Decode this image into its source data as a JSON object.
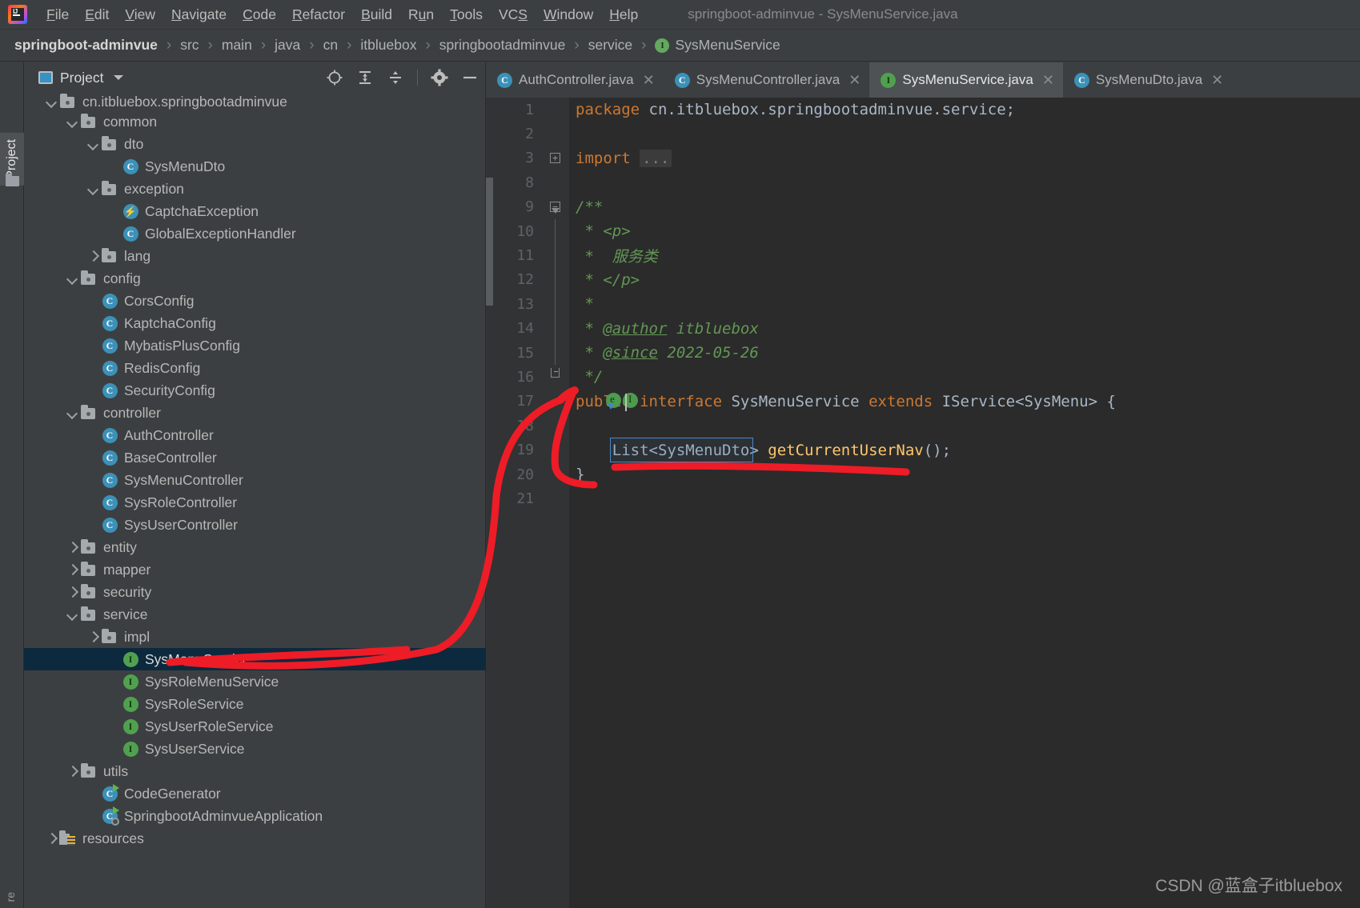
{
  "window": {
    "title": "springboot-adminvue - SysMenuService.java",
    "logo_icon": "intellij-idea-logo"
  },
  "menubar": {
    "items": [
      {
        "label": "File",
        "mnemonic": "F"
      },
      {
        "label": "Edit",
        "mnemonic": "E"
      },
      {
        "label": "View",
        "mnemonic": "V"
      },
      {
        "label": "Navigate",
        "mnemonic": "N"
      },
      {
        "label": "Code",
        "mnemonic": "C"
      },
      {
        "label": "Refactor",
        "mnemonic": "R"
      },
      {
        "label": "Build",
        "mnemonic": "B"
      },
      {
        "label": "Run",
        "mnemonic": "u"
      },
      {
        "label": "Tools",
        "mnemonic": "T"
      },
      {
        "label": "VCS",
        "mnemonic": "S"
      },
      {
        "label": "Window",
        "mnemonic": "W"
      },
      {
        "label": "Help",
        "mnemonic": "H"
      }
    ]
  },
  "breadcrumb": {
    "separator": "›",
    "items": [
      {
        "label": "springboot-adminvue",
        "icon": null
      },
      {
        "label": "src",
        "icon": null
      },
      {
        "label": "main",
        "icon": null
      },
      {
        "label": "java",
        "icon": null
      },
      {
        "label": "cn",
        "icon": null
      },
      {
        "label": "itbluebox",
        "icon": null
      },
      {
        "label": "springbootadminvue",
        "icon": null
      },
      {
        "label": "service",
        "icon": null
      },
      {
        "label": "SysMenuService",
        "icon": "interface-badge"
      }
    ]
  },
  "left_strip": {
    "tab_label": "Project",
    "tab_icon": "project-folder-icon",
    "bottom_label": "re"
  },
  "project_panel": {
    "title": "Project",
    "title_icon": "project-view-icon",
    "caret_icon": "chevron-down-icon",
    "toolbar": [
      {
        "name": "select-opened-file-icon",
        "label": "Select Opened File"
      },
      {
        "name": "expand-all-icon",
        "label": "Expand All"
      },
      {
        "name": "collapse-all-icon",
        "label": "Collapse All"
      },
      {
        "name": "gear-icon",
        "label": "Settings"
      },
      {
        "name": "hide-icon",
        "label": "Hide"
      }
    ],
    "tree": [
      {
        "label": "cn.itbluebox.springbootadminvue",
        "indent": 2,
        "twist": "down",
        "icon": "package",
        "clipped": true,
        "selected": false
      },
      {
        "label": "common",
        "indent": 3,
        "twist": "down",
        "icon": "folder",
        "selected": false
      },
      {
        "label": "dto",
        "indent": 4,
        "twist": "down",
        "icon": "folder",
        "selected": false
      },
      {
        "label": "SysMenuDto",
        "indent": 5,
        "twist": "none",
        "icon": "class",
        "selected": false
      },
      {
        "label": "exception",
        "indent": 4,
        "twist": "down",
        "icon": "folder",
        "selected": false
      },
      {
        "label": "CaptchaException",
        "indent": 5,
        "twist": "none",
        "icon": "exception",
        "selected": false
      },
      {
        "label": "GlobalExceptionHandler",
        "indent": 5,
        "twist": "none",
        "icon": "class",
        "selected": false
      },
      {
        "label": "lang",
        "indent": 4,
        "twist": "right",
        "icon": "folder",
        "selected": false
      },
      {
        "label": "config",
        "indent": 3,
        "twist": "down",
        "icon": "folder",
        "selected": false
      },
      {
        "label": "CorsConfig",
        "indent": 4,
        "twist": "none",
        "icon": "class",
        "selected": false
      },
      {
        "label": "KaptchaConfig",
        "indent": 4,
        "twist": "none",
        "icon": "class",
        "selected": false
      },
      {
        "label": "MybatisPlusConfig",
        "indent": 4,
        "twist": "none",
        "icon": "class",
        "selected": false
      },
      {
        "label": "RedisConfig",
        "indent": 4,
        "twist": "none",
        "icon": "class",
        "selected": false
      },
      {
        "label": "SecurityConfig",
        "indent": 4,
        "twist": "none",
        "icon": "class",
        "selected": false
      },
      {
        "label": "controller",
        "indent": 3,
        "twist": "down",
        "icon": "folder",
        "selected": false
      },
      {
        "label": "AuthController",
        "indent": 4,
        "twist": "none",
        "icon": "class",
        "selected": false
      },
      {
        "label": "BaseController",
        "indent": 4,
        "twist": "none",
        "icon": "class",
        "selected": false
      },
      {
        "label": "SysMenuController",
        "indent": 4,
        "twist": "none",
        "icon": "class",
        "selected": false
      },
      {
        "label": "SysRoleController",
        "indent": 4,
        "twist": "none",
        "icon": "class",
        "selected": false
      },
      {
        "label": "SysUserController",
        "indent": 4,
        "twist": "none",
        "icon": "class",
        "selected": false
      },
      {
        "label": "entity",
        "indent": 3,
        "twist": "right",
        "icon": "folder",
        "selected": false
      },
      {
        "label": "mapper",
        "indent": 3,
        "twist": "right",
        "icon": "folder",
        "selected": false
      },
      {
        "label": "security",
        "indent": 3,
        "twist": "right",
        "icon": "folder",
        "selected": false
      },
      {
        "label": "service",
        "indent": 3,
        "twist": "down",
        "icon": "folder",
        "selected": false
      },
      {
        "label": "impl",
        "indent": 4,
        "twist": "right",
        "icon": "folder",
        "selected": false
      },
      {
        "label": "SysMenuService",
        "indent": 5,
        "twist": "none",
        "icon": "interface",
        "selected": true
      },
      {
        "label": "SysRoleMenuService",
        "indent": 5,
        "twist": "none",
        "icon": "interface",
        "selected": false
      },
      {
        "label": "SysRoleService",
        "indent": 5,
        "twist": "none",
        "icon": "interface",
        "selected": false
      },
      {
        "label": "SysUserRoleService",
        "indent": 5,
        "twist": "none",
        "icon": "interface",
        "selected": false
      },
      {
        "label": "SysUserService",
        "indent": 5,
        "twist": "none",
        "icon": "interface",
        "selected": false
      },
      {
        "label": "utils",
        "indent": 3,
        "twist": "right",
        "icon": "folder",
        "selected": false
      },
      {
        "label": "CodeGenerator",
        "indent": 4,
        "twist": "none",
        "icon": "runnable-class",
        "selected": false
      },
      {
        "label": "SpringbootAdminvueApplication",
        "indent": 4,
        "twist": "none",
        "icon": "spring-boot-class",
        "selected": false
      },
      {
        "label": "resources",
        "indent": 2,
        "twist": "right",
        "icon": "resources-folder",
        "selected": false
      }
    ]
  },
  "editor": {
    "tabs": [
      {
        "label": "AuthController.java",
        "icon": "class-badge",
        "active": false,
        "closeable": true
      },
      {
        "label": "SysMenuController.java",
        "icon": "class-badge",
        "active": false,
        "closeable": true
      },
      {
        "label": "SysMenuService.java",
        "icon": "interface-badge",
        "active": true,
        "closeable": true
      },
      {
        "label": "SysMenuDto.java",
        "icon": "class-badge",
        "active": false,
        "closeable": true
      }
    ],
    "close_glyph": "✕",
    "lines": [
      {
        "num": "1",
        "fold": "none",
        "tokens": [
          {
            "t": "package ",
            "c": "kw"
          },
          {
            "t": "cn.itbluebox.springbootadminvue.service",
            "c": "pl"
          },
          {
            "t": ";",
            "c": "pl"
          }
        ]
      },
      {
        "num": "2",
        "fold": "none",
        "tokens": []
      },
      {
        "num": "3",
        "fold": "plus",
        "tokens": [
          {
            "t": "import ",
            "c": "kw"
          },
          {
            "t": "...",
            "c": "foldbox"
          }
        ]
      },
      {
        "num": "8",
        "fold": "none",
        "tokens": []
      },
      {
        "num": "9",
        "fold": "start",
        "tokens": [
          {
            "t": "/**",
            "c": "cm"
          }
        ]
      },
      {
        "num": "10",
        "fold": "line",
        "tokens": [
          {
            "t": " * <p>",
            "c": "cm"
          }
        ]
      },
      {
        "num": "11",
        "fold": "line",
        "tokens": [
          {
            "t": " *  服务类",
            "c": "cm"
          }
        ]
      },
      {
        "num": "12",
        "fold": "line",
        "tokens": [
          {
            "t": " * </p>",
            "c": "cm"
          }
        ]
      },
      {
        "num": "13",
        "fold": "line",
        "tokens": [
          {
            "t": " *",
            "c": "cm"
          }
        ]
      },
      {
        "num": "14",
        "fold": "line",
        "tokens": [
          {
            "t": " * ",
            "c": "cm"
          },
          {
            "t": "@author",
            "c": "cmtag"
          },
          {
            "t": " itbluebox",
            "c": "cm"
          }
        ]
      },
      {
        "num": "15",
        "fold": "line",
        "tokens": [
          {
            "t": " * ",
            "c": "cm"
          },
          {
            "t": "@since",
            "c": "cmtag"
          },
          {
            "t": " 2022-05-26",
            "c": "cm"
          }
        ]
      },
      {
        "num": "16",
        "fold": "end",
        "tokens": [
          {
            "t": " */",
            "c": "cm"
          }
        ]
      },
      {
        "num": "17",
        "fold": "icons",
        "tokens": [
          {
            "t": "public ",
            "c": "kw"
          },
          {
            "t": "interface ",
            "c": "kw"
          },
          {
            "t": "SysMenuService ",
            "c": "typ"
          },
          {
            "t": "extends ",
            "c": "kw"
          },
          {
            "t": "IService<SysMenu> {",
            "c": "typ"
          }
        ]
      },
      {
        "num": "18",
        "fold": "none",
        "tokens": []
      },
      {
        "num": "19",
        "fold": "none",
        "tokens": [
          {
            "t": "    ",
            "c": "pl"
          },
          {
            "t": "List<SysMenuDto>",
            "c": "typ"
          },
          {
            "t": " ",
            "c": "pl"
          },
          {
            "t": "getCurrentUserNav",
            "c": "mth"
          },
          {
            "t": "();",
            "c": "pl"
          }
        ]
      },
      {
        "num": "20",
        "fold": "none",
        "tokens": [
          {
            "t": "}",
            "c": "pl"
          }
        ]
      },
      {
        "num": "21",
        "fold": "none",
        "tokens": []
      }
    ]
  },
  "annotation": {
    "color": "#ee1c26",
    "description": "hand-drawn red arrow linking SysMenuService tree node to interface declaration and underlining the getCurrentUserNav method"
  },
  "watermark": {
    "text": "CSDN @蓝盒子itbluebox"
  },
  "colors": {
    "background": "#3c3f41",
    "editor_background": "#2b2b2b",
    "gutter": "#313335",
    "selection": "#0d293e",
    "accent_blue": "#3b91b8",
    "accent_green": "#50a14f",
    "keyword_orange": "#cc7832",
    "comment_green": "#629755",
    "method_yellow": "#ffc66d",
    "annotation_red": "#ee1c26"
  }
}
